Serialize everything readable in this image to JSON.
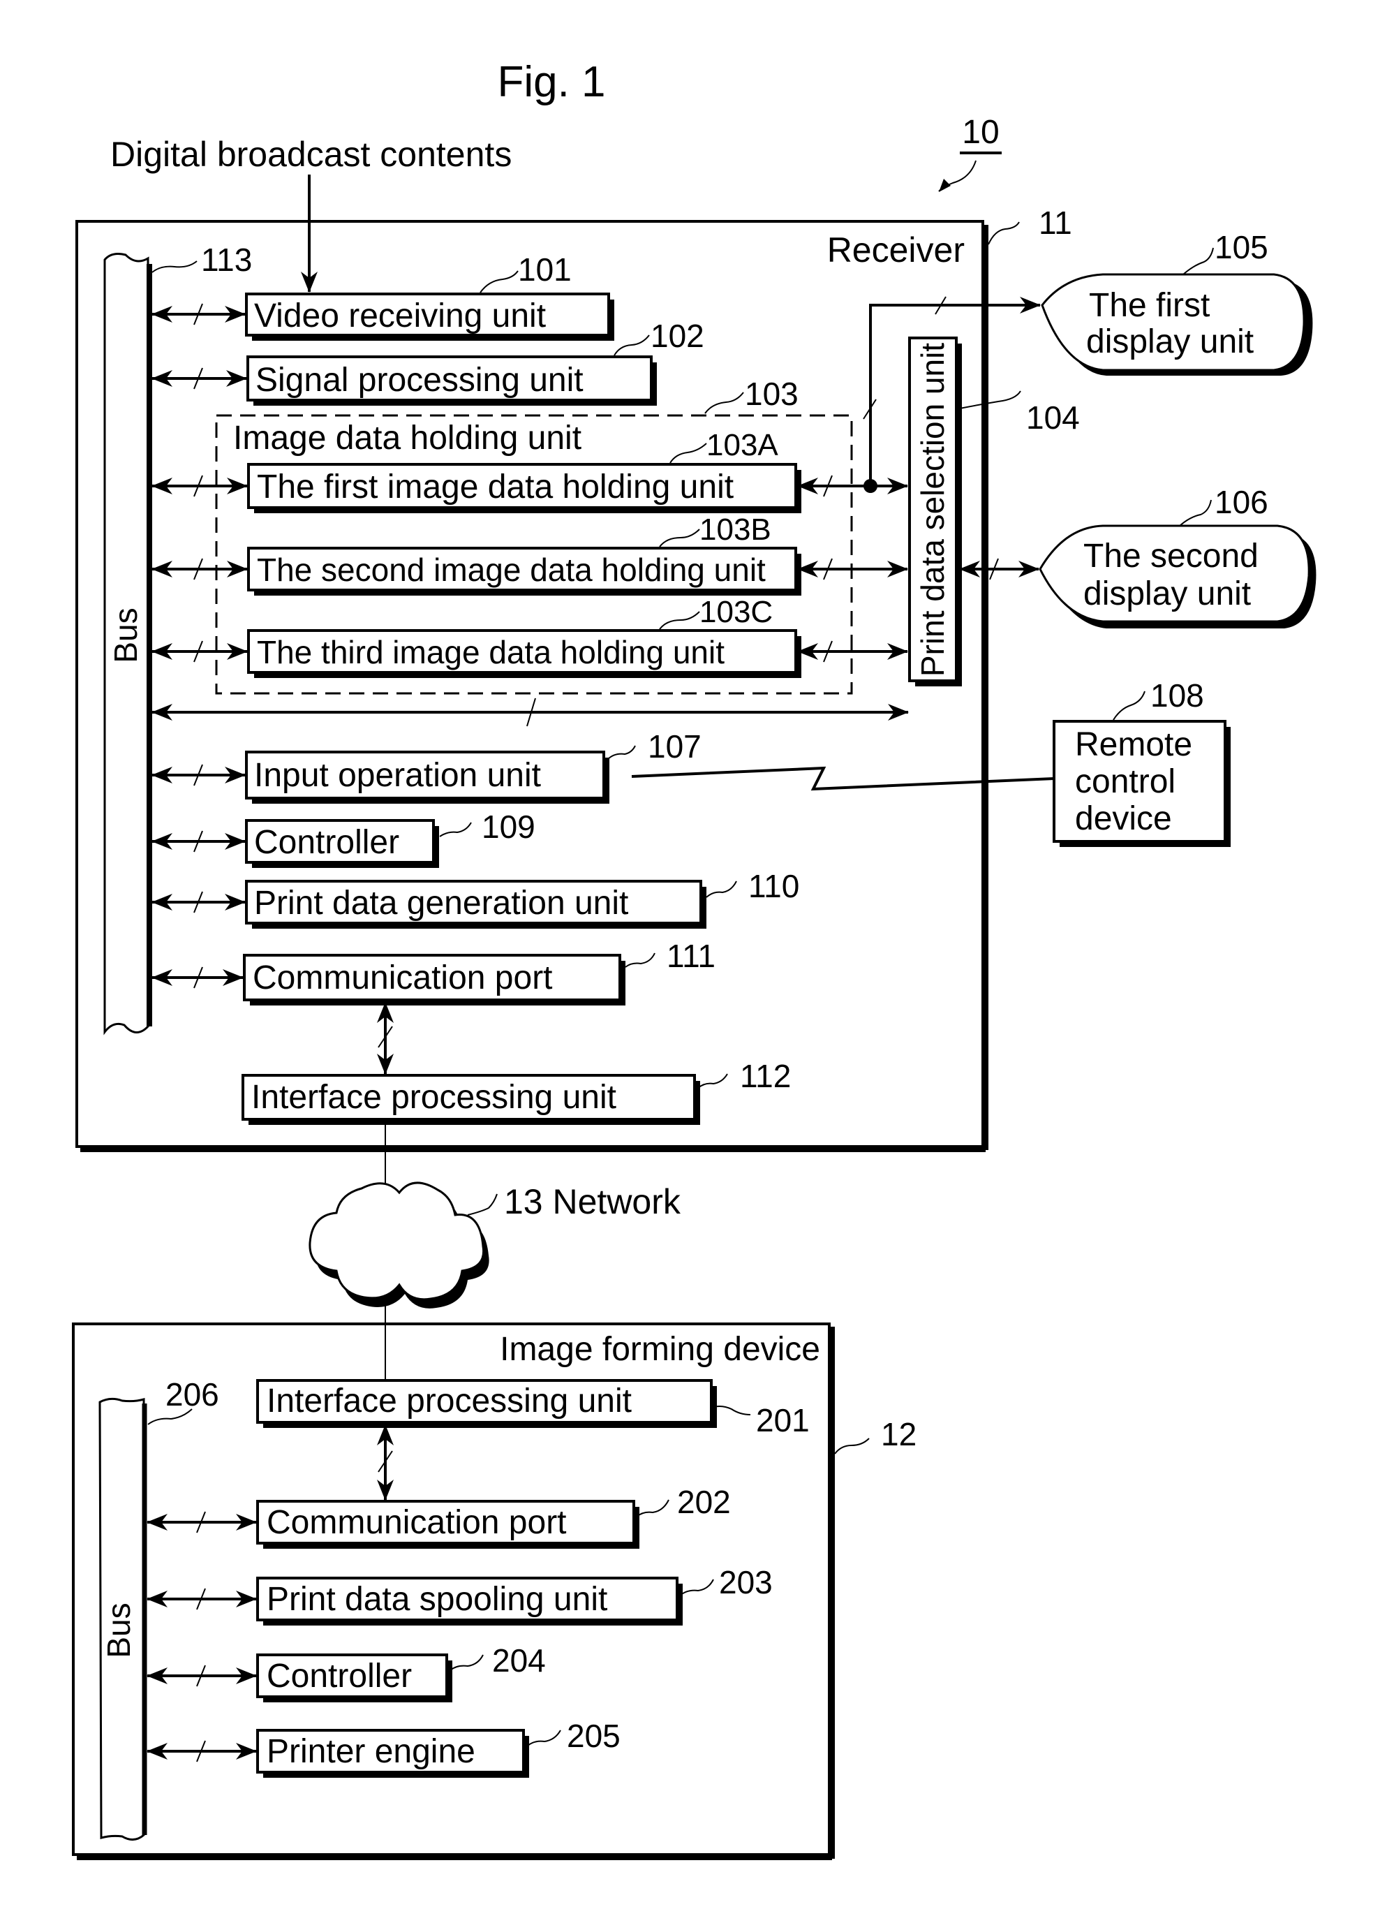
{
  "figure": {
    "title": "Fig. 1",
    "system_ref": "10",
    "input_label": "Digital broadcast contents"
  },
  "receiver": {
    "title": "Receiver",
    "ref": "11",
    "bus": {
      "label": "Bus",
      "ref": "113"
    },
    "units": [
      {
        "id": "video-receiving",
        "label": "Video receiving unit",
        "ref": "101"
      },
      {
        "id": "signal-processing",
        "label": "Signal processing unit",
        "ref": "102"
      },
      {
        "id": "first-image-holding",
        "label": "The first image data holding unit",
        "ref": "103A"
      },
      {
        "id": "second-image-holding",
        "label": "The second image data holding unit",
        "ref": "103B"
      },
      {
        "id": "third-image-holding",
        "label": "The third image data holding unit",
        "ref": "103C"
      },
      {
        "id": "input-operation",
        "label": "Input operation unit",
        "ref": "107"
      },
      {
        "id": "controller",
        "label": "Controller",
        "ref": "109"
      },
      {
        "id": "print-data-generation",
        "label": "Print data generation unit",
        "ref": "110"
      },
      {
        "id": "communication-port",
        "label": "Communication port",
        "ref": "111"
      },
      {
        "id": "interface-processing",
        "label": "Interface processing unit",
        "ref": "112"
      }
    ],
    "image_data_holding_group": {
      "label": "Image data holding unit",
      "ref": "103"
    },
    "print_data_selection": {
      "label": "Print data selection unit",
      "ref": "104"
    }
  },
  "external": {
    "first_display": {
      "line1": "The first",
      "line2": "display unit",
      "ref": "105"
    },
    "second_display": {
      "line1": "The second",
      "line2": "display unit",
      "ref": "106"
    },
    "remote_control": {
      "line1": "Remote",
      "line2": "control",
      "line3": "device",
      "ref": "108"
    }
  },
  "network": {
    "label": "13 Network"
  },
  "image_forming_device": {
    "title": "Image forming device",
    "ref": "12",
    "bus": {
      "label": "Bus",
      "ref": "206"
    },
    "units": [
      {
        "id": "interface-processing",
        "label": "Interface processing unit",
        "ref": "201"
      },
      {
        "id": "communication-port",
        "label": "Communication port",
        "ref": "202"
      },
      {
        "id": "print-data-spooling",
        "label": "Print data spooling unit",
        "ref": "203"
      },
      {
        "id": "controller",
        "label": "Controller",
        "ref": "204"
      },
      {
        "id": "printer-engine",
        "label": "Printer engine",
        "ref": "205"
      }
    ]
  }
}
